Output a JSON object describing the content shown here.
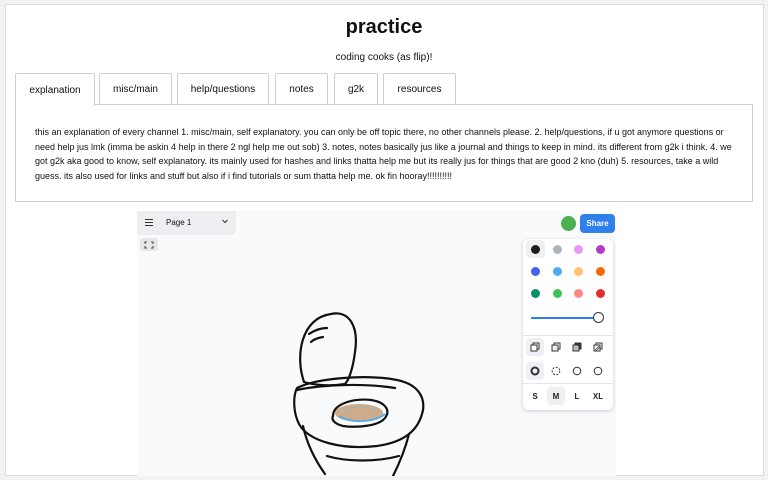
{
  "page": {
    "title": "practice",
    "subtitle": "coding cooks (as flip)!"
  },
  "tabs": [
    {
      "label": "explanation",
      "active": true
    },
    {
      "label": "misc/main"
    },
    {
      "label": "help/questions"
    },
    {
      "label": "notes"
    },
    {
      "label": "g2k"
    },
    {
      "label": "resources"
    }
  ],
  "panel": {
    "text": "this an explanation of every channel 1. misc/main, self explanatory. you can only be off topic there, no other channels please. 2. help/questions, if u got anymore questions or need help jus lmk (imma be askin 4 help in there 2 ngl help me out sob) 3. notes, notes basically jus like a journal and things to keep in mind. its different from g2k i think. 4. we got g2k aka good to know, self explanatory. its mainly used for hashes and links thatta help me but its really jus for things that are good 2 kno (duh) 5. resources, take a wild guess. its also used for links and stuff but also if i find tutorials or sum thatta help me. ok fin hooray!!!!!!!!!!"
  },
  "whiteboard": {
    "page_label": "Page 1",
    "share_label": "Share",
    "avatar_color": "#4caf50",
    "accent_color": "#2f80ed",
    "icons": [
      "menu-icon",
      "chevron-down-icon",
      "fullscreen-icon"
    ],
    "colors": [
      "#1d1d1d",
      "#adb5bd",
      "#e599f7",
      "#ae3ec9",
      "#4263eb",
      "#4dabf7",
      "#ffc078",
      "#f76707",
      "#099268",
      "#40c057",
      "#ff8787",
      "#e03131"
    ],
    "selected_color": "#1d1d1d",
    "opacity": 1.0,
    "fill_options": [
      "fill-none-icon",
      "fill-semi-icon",
      "fill-solid-icon",
      "fill-pattern-icon"
    ],
    "dash_options": [
      "dash-draw-icon",
      "dash-dashed-icon",
      "dash-dotted-icon",
      "dash-solid-icon"
    ],
    "sizes": [
      "S",
      "M",
      "L",
      "XL"
    ],
    "selected_size": "M"
  }
}
